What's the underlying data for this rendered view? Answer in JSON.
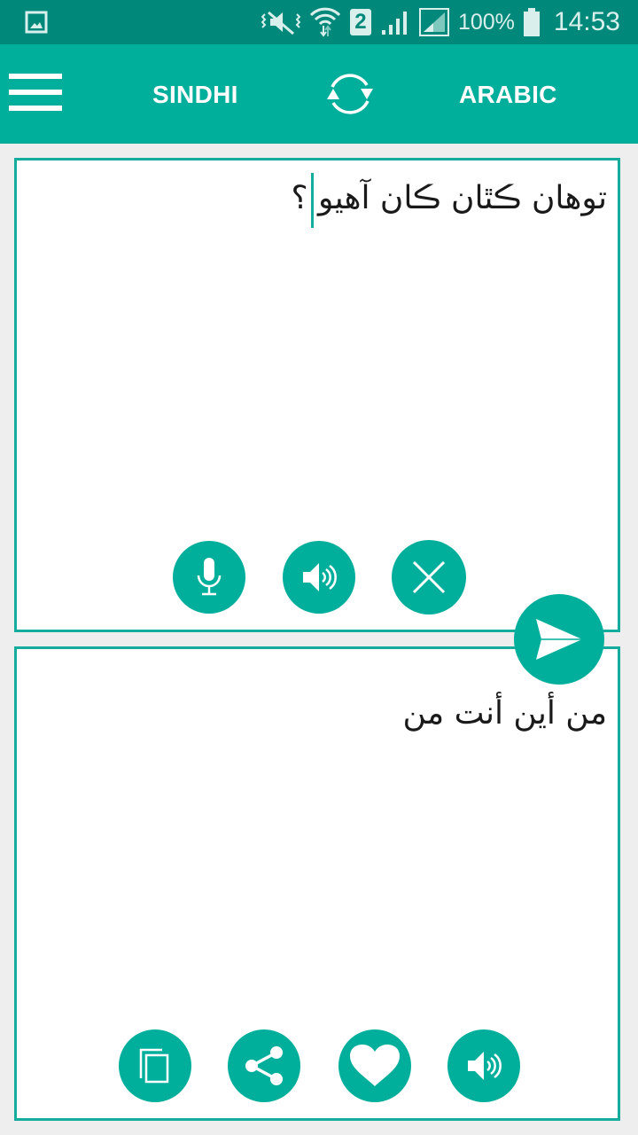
{
  "status_bar": {
    "battery_percent": "100%",
    "time": "14:53",
    "sim_slot": "2",
    "icons": [
      "gallery-icon",
      "vibrate-mute-icon",
      "wifi-icon",
      "sim-2-icon",
      "signal-icon",
      "signal-2-icon",
      "battery-icon"
    ]
  },
  "app_bar": {
    "menu_icon": "hamburger-menu-icon",
    "source_language": "SINDHI",
    "swap_icon": "swap-languages-icon",
    "target_language": "ARABIC"
  },
  "source_panel": {
    "text": "توهان ڪٿان ڪان آهيو ؟",
    "buttons": [
      {
        "name": "microphone",
        "icon": "microphone-icon"
      },
      {
        "name": "speak-source",
        "icon": "speaker-icon"
      },
      {
        "name": "clear",
        "icon": "close-icon"
      }
    ]
  },
  "translate_button": {
    "icon": "send-icon"
  },
  "target_panel": {
    "text": "من أين أنت من",
    "buttons": [
      {
        "name": "copy",
        "icon": "copy-icon"
      },
      {
        "name": "share",
        "icon": "share-icon"
      },
      {
        "name": "favorite",
        "icon": "heart-icon"
      },
      {
        "name": "speak-target",
        "icon": "speaker-icon"
      }
    ]
  },
  "colors": {
    "status_bar": "#00897b",
    "primary": "#00af9b",
    "panel_border": "#14ad9d",
    "background": "#eeeeee"
  }
}
